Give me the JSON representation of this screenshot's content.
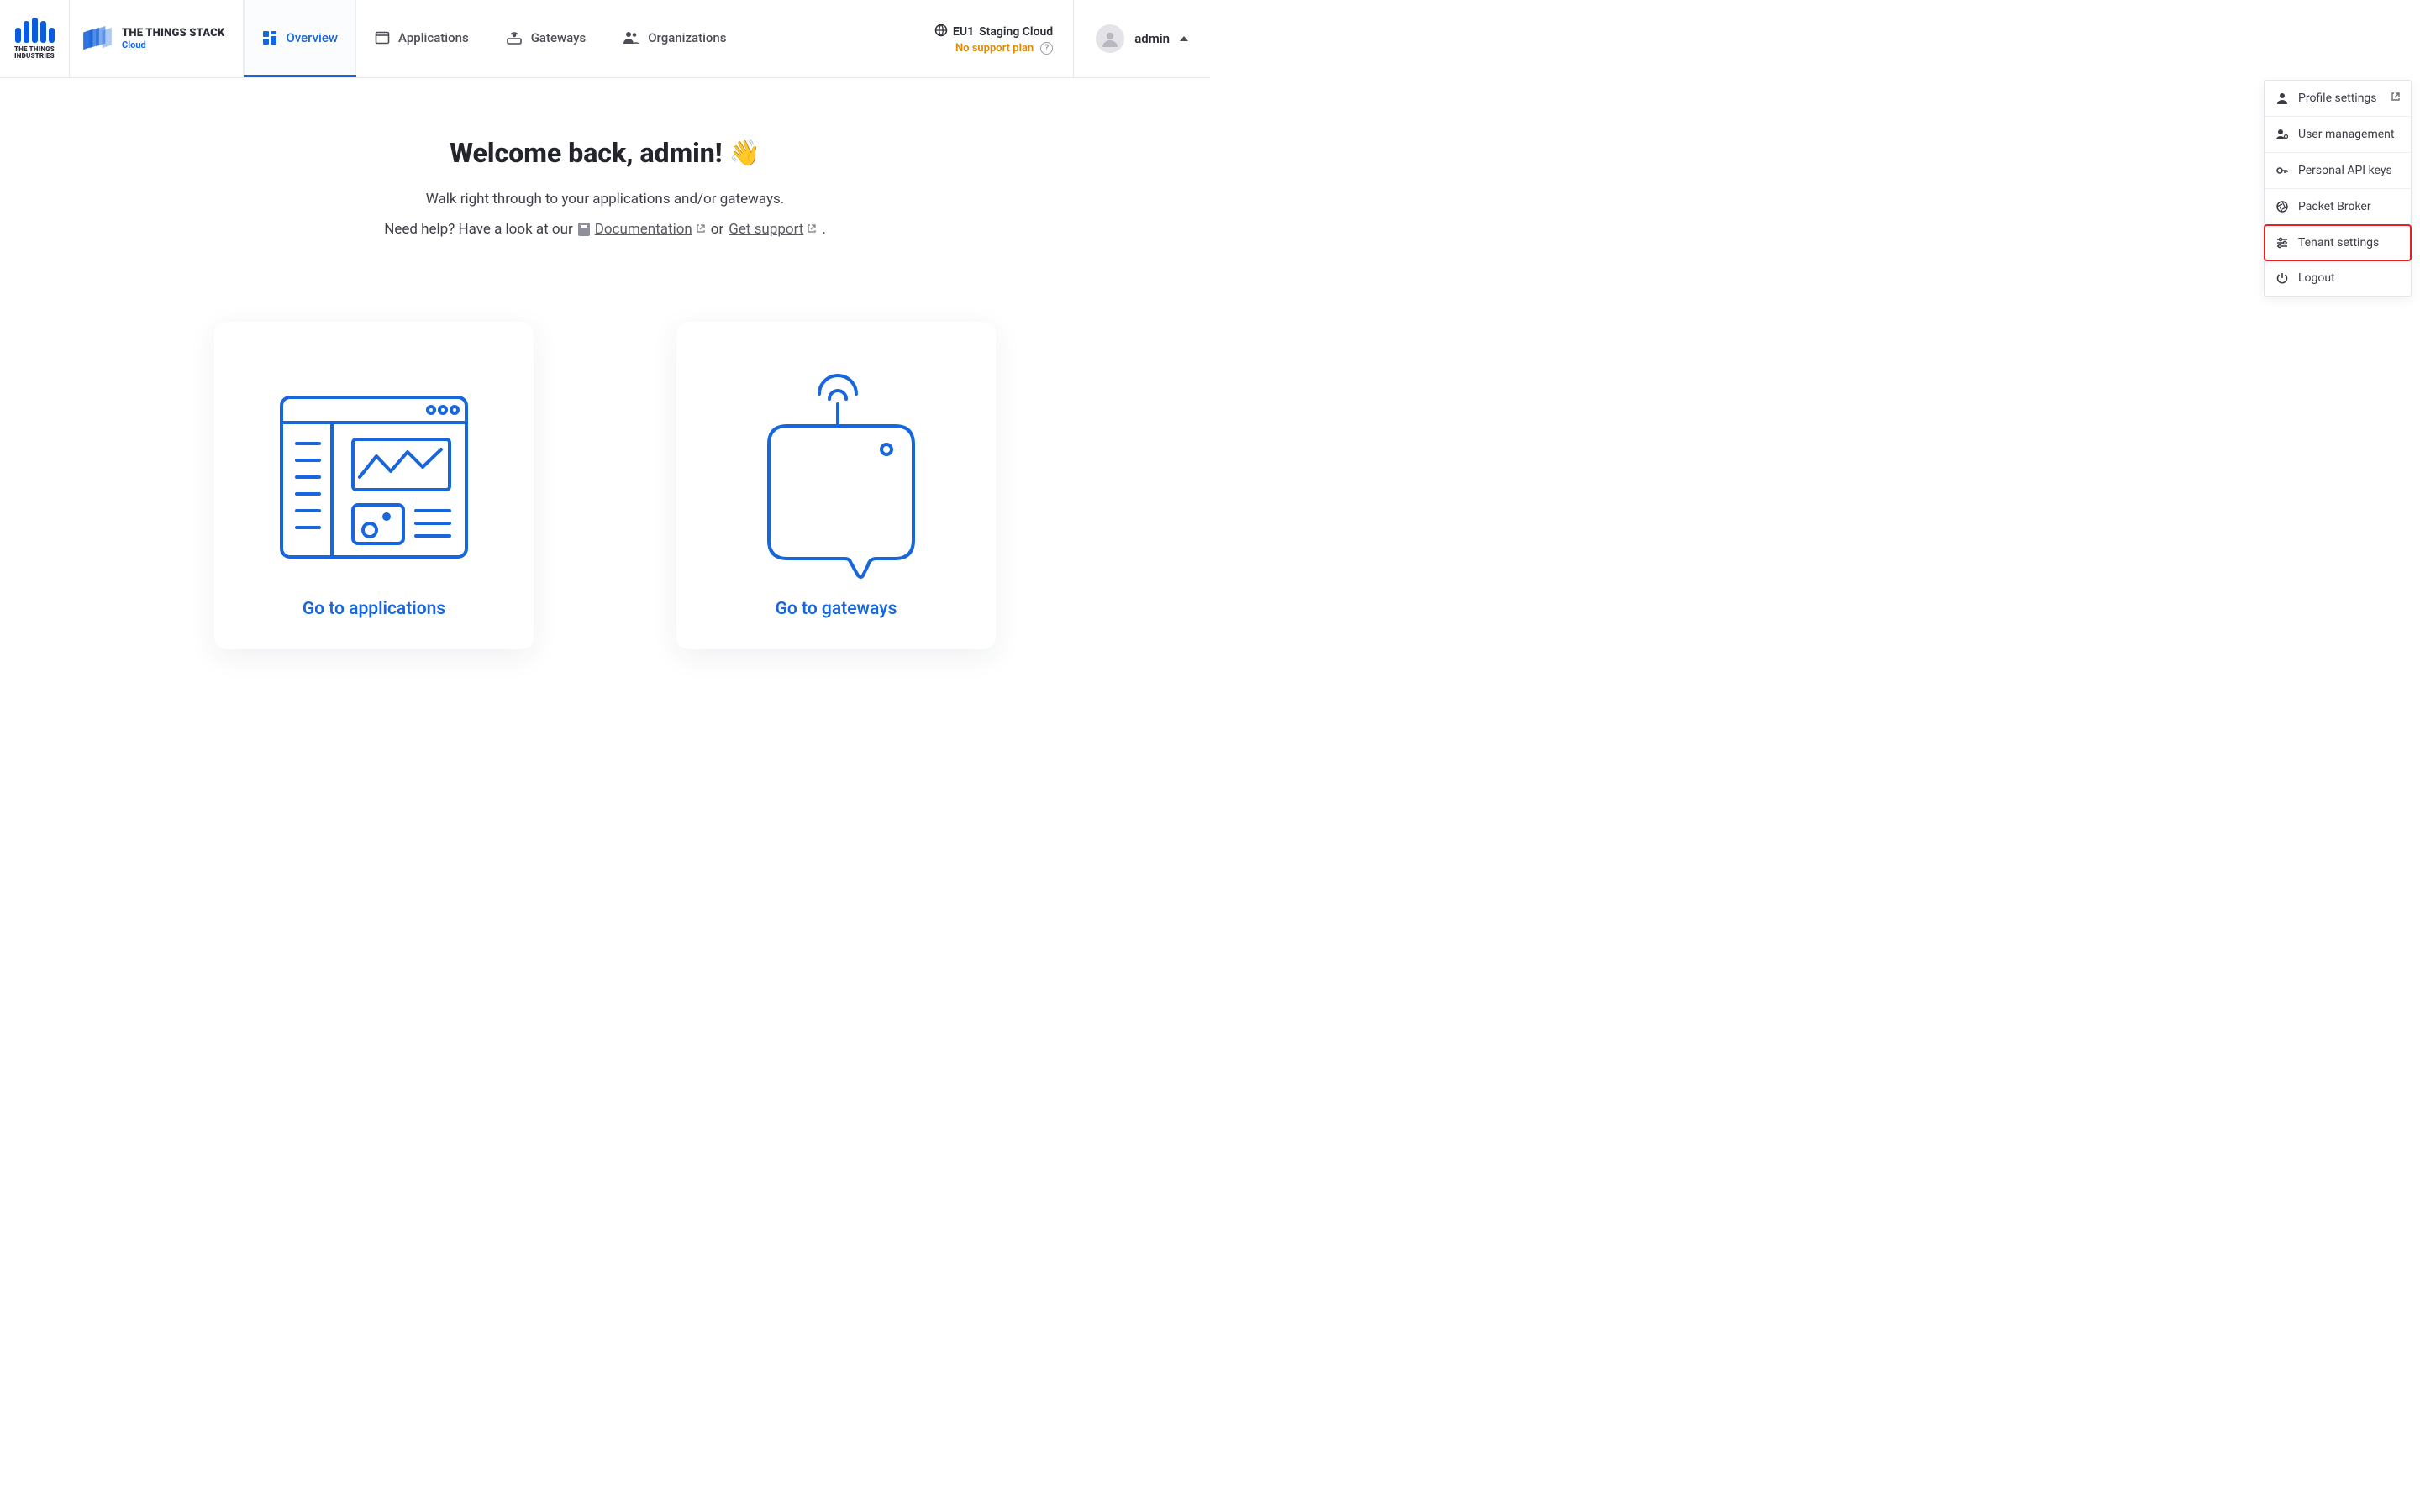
{
  "logo": {
    "company": "THE THINGS\nINDUSTRIES"
  },
  "brand": {
    "line1": "THE THINGS STACK",
    "line2": "Cloud"
  },
  "nav": {
    "overview": "Overview",
    "applications": "Applications",
    "gateways": "Gateways",
    "organizations": "Organizations"
  },
  "cluster": {
    "id": "EU1",
    "name": "Staging Cloud",
    "support": "No support plan"
  },
  "user": {
    "name": "admin"
  },
  "dropdown": {
    "profile": "Profile settings",
    "userMgmt": "User management",
    "apiKeys": "Personal API keys",
    "packetBroker": "Packet Broker",
    "tenant": "Tenant settings",
    "logout": "Logout"
  },
  "main": {
    "welcome": "Welcome back, admin!",
    "sub": "Walk right through to your applications and/or gateways.",
    "helpPrefix": "Need help? Have a look at our",
    "doc": "Documentation",
    "or": "or",
    "support": "Get support",
    "dot": "."
  },
  "cards": {
    "apps": "Go to applications",
    "gws": "Go to gateways"
  }
}
